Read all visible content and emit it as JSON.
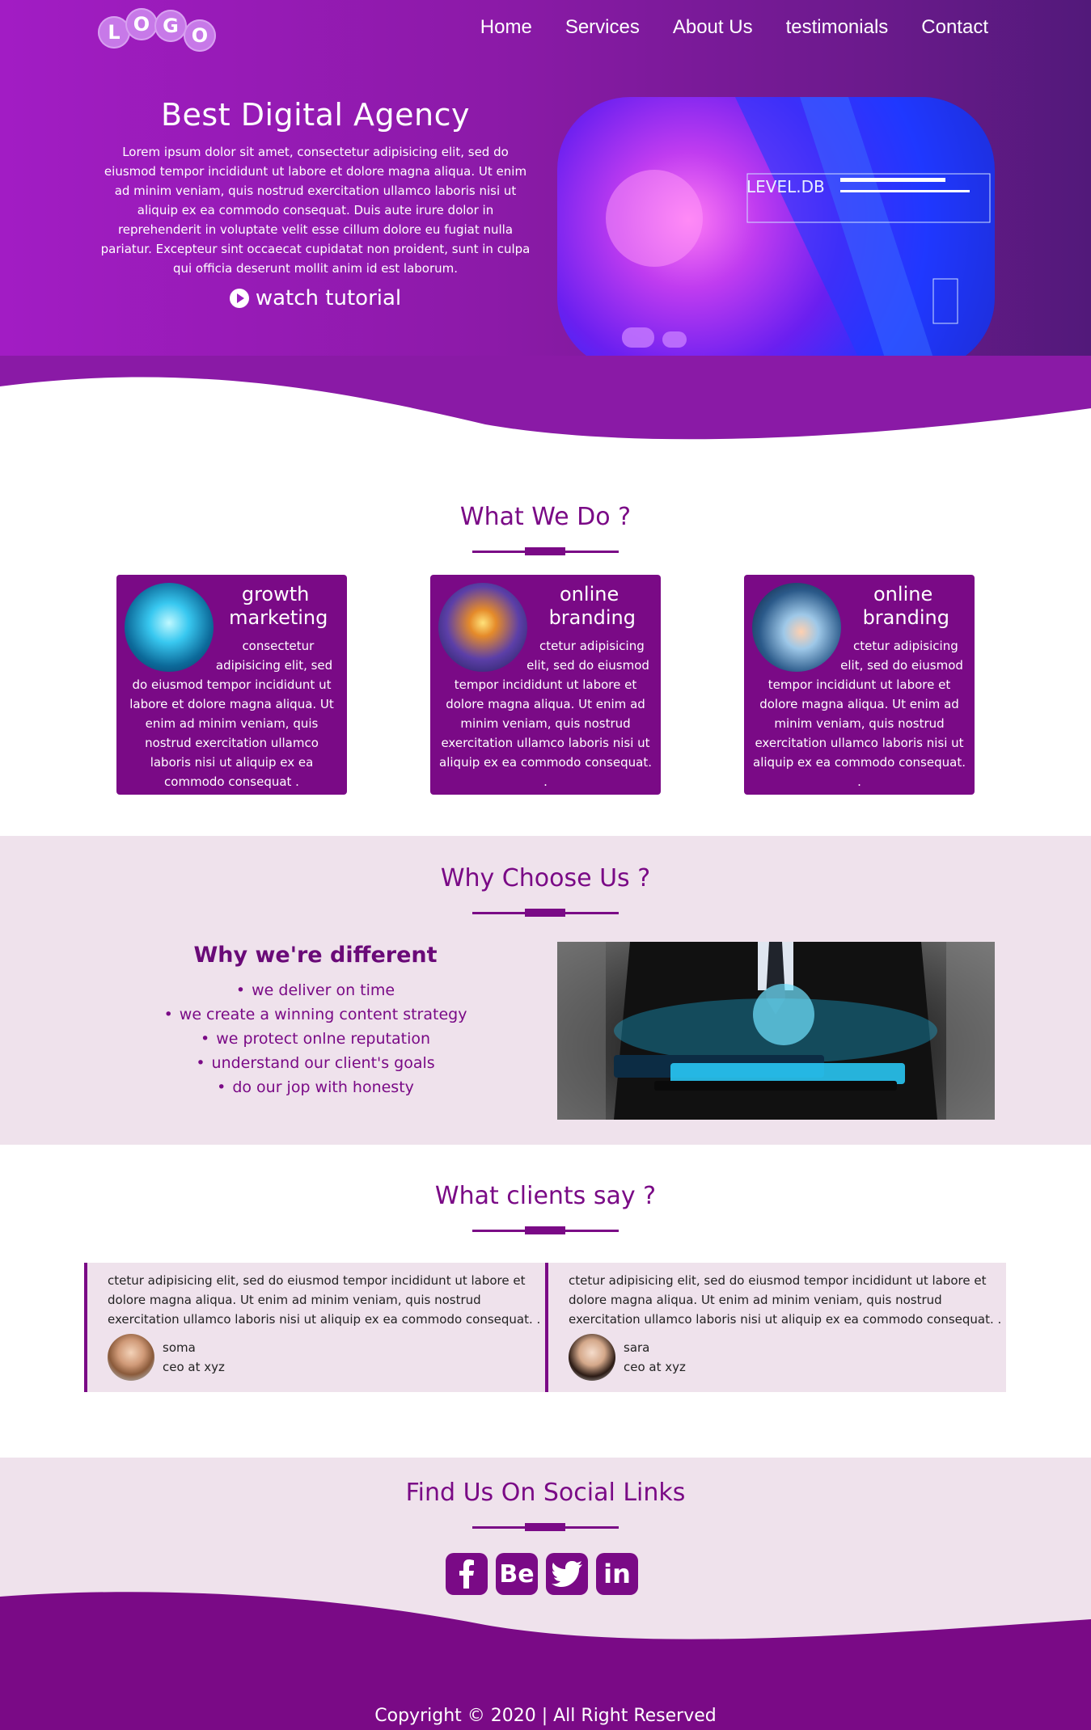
{
  "brand": {
    "logo_letters": [
      "L",
      "O",
      "G",
      "O"
    ],
    "primary_color": "#7a0a86",
    "hero_gradient": [
      "#a21cc4",
      "#52197a"
    ]
  },
  "nav": {
    "items": [
      "Home",
      "Services",
      "About Us",
      "testimonials",
      "Contact"
    ]
  },
  "hero": {
    "title": "Best Digital Agency",
    "paragraph": "Lorem ipsum dolor sit amet, consectetur adipisicing elit, sed do eiusmod tempor incididunt ut labore et dolore magna aliqua. Ut enim ad minim veniam, quis nostrud exercitation ullamco laboris nisi ut aliquip ex ea commodo consequat. Duis aute irure dolor in reprehenderit in voluptate velit esse cillum dolore eu fugiat nulla pariatur. Excepteur sint occaecat cupidatat non proident, sunt in culpa qui officia deserunt mollit anim id est laborum.",
    "watch_label": "watch tutorial",
    "image_text": "LEVEL.DB"
  },
  "what_we_do": {
    "title": "What We Do ?",
    "cards": [
      {
        "title": "growth marketing",
        "text": "consectetur adipisicing elit, sed do eiusmod tempor incididunt ut labore et dolore magna aliqua. Ut enim ad minim veniam, quis nostrud exercitation ullamco laboris nisi ut aliquip ex ea commodo consequat ."
      },
      {
        "title": "online branding",
        "text": "ctetur adipisicing elit, sed do eiusmod tempor incididunt ut labore et dolore magna aliqua. Ut enim ad minim veniam, quis nostrud exercitation ullamco laboris nisi ut aliquip ex ea commodo consequat. ."
      },
      {
        "title": "online branding",
        "text": "ctetur adipisicing elit, sed do eiusmod tempor incididunt ut labore et dolore magna aliqua. Ut enim ad minim veniam, quis nostrud exercitation ullamco laboris nisi ut aliquip ex ea commodo consequat. ."
      }
    ]
  },
  "why_choose": {
    "title": "Why Choose Us ?",
    "subtitle": "Why we're different",
    "items": [
      "we deliver on time",
      "we create a winning content strategy",
      "we protect onlne reputation",
      "understand our client's goals",
      "do our jop with honesty"
    ]
  },
  "clients": {
    "title": "What clients say ?",
    "testimonials": [
      {
        "text": "ctetur adipisicing elit, sed do eiusmod tempor incididunt ut labore et dolore magna aliqua. Ut enim ad minim veniam, quis nostrud exercitation ullamco laboris nisi ut aliquip ex ea commodo consequat. .",
        "name": "soma",
        "role": "ceo at xyz"
      },
      {
        "text": "ctetur adipisicing elit, sed do eiusmod tempor incididunt ut labore et dolore magna aliqua. Ut enim ad minim veniam, quis nostrud exercitation ullamco laboris nisi ut aliquip ex ea commodo consequat. .",
        "name": "sara",
        "role": "ceo at xyz"
      }
    ]
  },
  "social": {
    "title": "Find Us On Social Links",
    "icons": [
      {
        "name": "facebook-icon",
        "glyph": "f"
      },
      {
        "name": "behance-icon",
        "glyph": "Be"
      },
      {
        "name": "twitter-icon",
        "glyph": "t"
      },
      {
        "name": "linkedin-icon",
        "glyph": "in"
      }
    ]
  },
  "footer": {
    "copyright": "Copyright © 2020 | All Right Reserved"
  }
}
